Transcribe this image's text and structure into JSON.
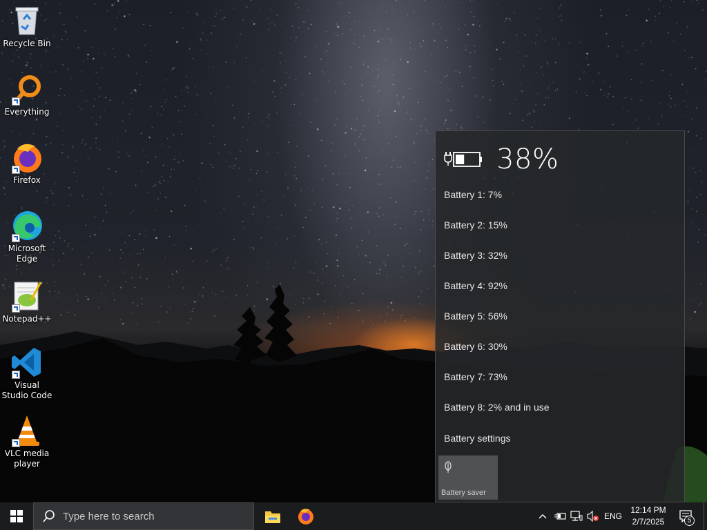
{
  "desktop": {
    "icons": [
      {
        "label": "Recycle Bin",
        "icon": "recycle-bin-icon"
      },
      {
        "label": "Everything",
        "icon": "everything-search-icon"
      },
      {
        "label": "Firefox",
        "icon": "firefox-icon"
      },
      {
        "label": "Microsoft Edge",
        "icon": "edge-icon"
      },
      {
        "label": "Notepad++",
        "icon": "notepad-plus-plus-icon"
      },
      {
        "label": "Visual Studio Code",
        "icon": "vscode-icon"
      },
      {
        "label": "VLC media player",
        "icon": "vlc-icon"
      }
    ]
  },
  "battery_flyout": {
    "percent_label": "38%",
    "charge_fraction": 0.38,
    "batteries": [
      "Battery 1: 7%",
      "Battery 2: 15%",
      "Battery 3: 32%",
      "Battery 4: 92%",
      "Battery 5: 56%",
      "Battery 6: 30%",
      "Battery 7: 73%",
      "Battery 8: 2% and in use"
    ],
    "settings_link": "Battery settings",
    "saver_tile": "Battery saver"
  },
  "taskbar": {
    "search_placeholder": "Type here to search",
    "pinned": [
      "file-explorer-icon",
      "firefox-icon"
    ],
    "tray": {
      "language": "ENG",
      "time": "12:14 PM",
      "date": "2/7/2025",
      "notification_count": "5"
    }
  },
  "colors": {
    "taskbar": "#1b1c1d",
    "flyout": "#26282a",
    "accent_blue": "#1e63c4"
  }
}
